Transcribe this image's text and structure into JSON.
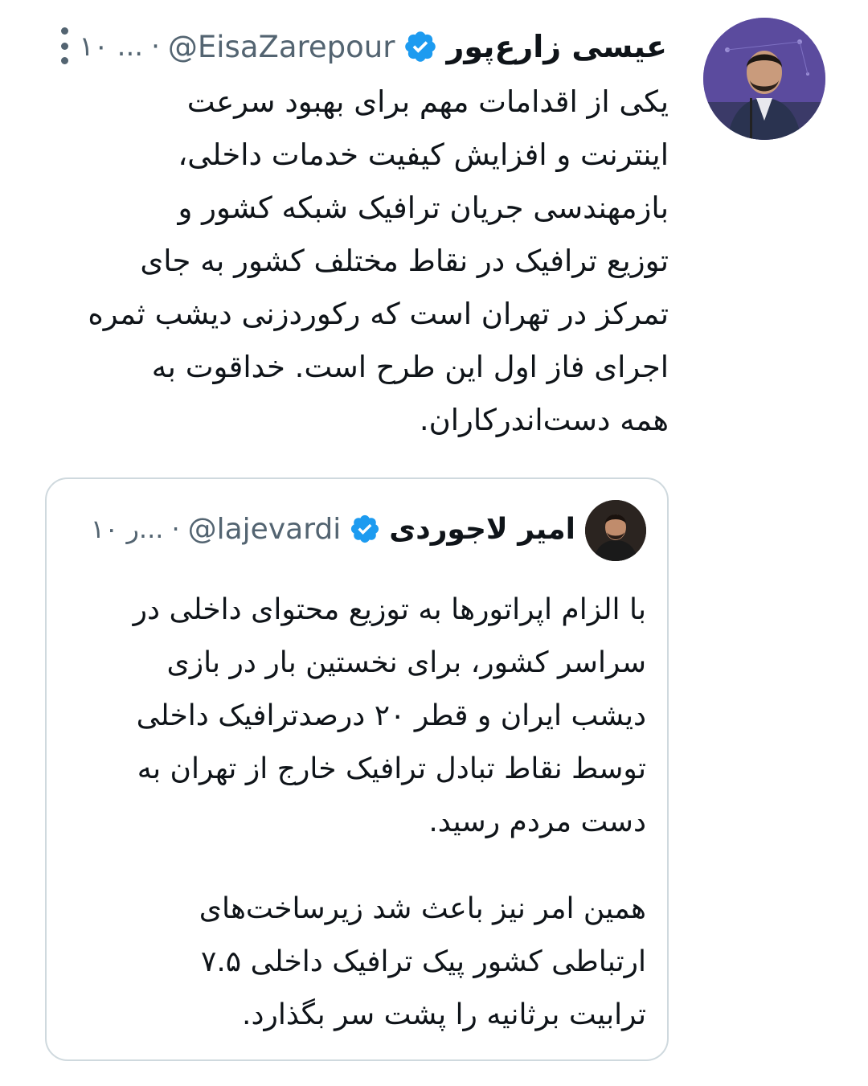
{
  "tweet": {
    "author_name": "عیسی زارع‌پور",
    "handle": "@EisaZarepour",
    "separator": "·",
    "time": "۱۰ ...",
    "more_icon": "more-vertical-icon",
    "verified_icon": "verified-badge-icon",
    "text": "یکی از اقدامات مهم برای بهبود سرعت\nاینترنت و افزایش کیفیت خدمات داخلی،\nبازمهندسی جریان ترافیک شبکه کشور و\nتوزیع ترافیک در نقاط مختلف کشور به جای\nتمرکز در تهران است که رکوردزنی دیشب ثمره\nاجرای فاز اول این طرح است. خداقوت به\nهمه دست‌اندرکاران."
  },
  "quoted": {
    "author_name": "امیر لاجوردی",
    "handle": "@lajevardi",
    "separator": "·",
    "time": "۱۰ ر...",
    "verified_icon": "verified-badge-icon",
    "paragraph1": "با الزام اپراتورها به توزیع محتوای داخلی در\nسراسر کشور، برای نخستین بار در بازی\nدیشب ایران و قطر ۲۰ درصدترافیک داخلی\nتوسط نقاط تبادل ترافیک خارج از تهران به\nدست مردم رسید.",
    "paragraph2": "همین امر نیز باعث شد زیرساخت‌های\nارتباطی کشور پیک ترافیک داخلی ۷.۵\nترابیت برثانیه را  پشت سر بگذارد."
  },
  "colors": {
    "text": "#0f1419",
    "secondary": "#536471",
    "verified": "#1d9bf0",
    "border": "#cfd9de",
    "avatar_bg": "#5b4b9e"
  }
}
